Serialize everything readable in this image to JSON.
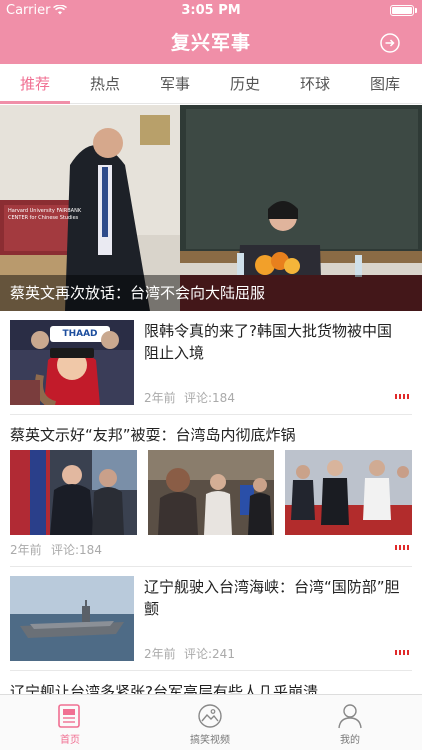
{
  "status": {
    "carrier": "Carrier",
    "time": "3:05 PM"
  },
  "nav": {
    "title": "复兴军事"
  },
  "tabs": [
    {
      "label": "推荐",
      "active": true
    },
    {
      "label": "热点"
    },
    {
      "label": "军事"
    },
    {
      "label": "历史"
    },
    {
      "label": "环球"
    },
    {
      "label": "图库"
    }
  ],
  "hero": {
    "caption": "蔡英文再次放话：台湾不会向大陆屈服",
    "sign_text": "Harvard University FAIRBANK CENTER for Chinese Studies"
  },
  "articles": [
    {
      "title": "限韩令真的来了?韩国大批货物被中国阻止入境",
      "time": "2年前",
      "comments": "评论:184",
      "sign": "THAAD"
    },
    {
      "title": "蔡英文示好“友邦”被耍：台湾岛内彻底炸锅",
      "time": "2年前",
      "comments": "评论:184"
    },
    {
      "title": "辽宁舰驶入台湾海峡：台湾“国防部”胆颤",
      "time": "2年前",
      "comments": "评论:241"
    },
    {
      "title": "辽宁舰让台湾多紧张?台军高层有些人几乎崩溃"
    }
  ],
  "bottom_nav": [
    {
      "label": "首页",
      "icon": "newspaper-icon",
      "active": true
    },
    {
      "label": "搞笑视频",
      "icon": "image-icon"
    },
    {
      "label": "我的",
      "icon": "person-icon"
    }
  ],
  "colors": {
    "accent": "#f08fa8",
    "accent_text": "#f06f92",
    "more_marker": "#e02a2a"
  }
}
